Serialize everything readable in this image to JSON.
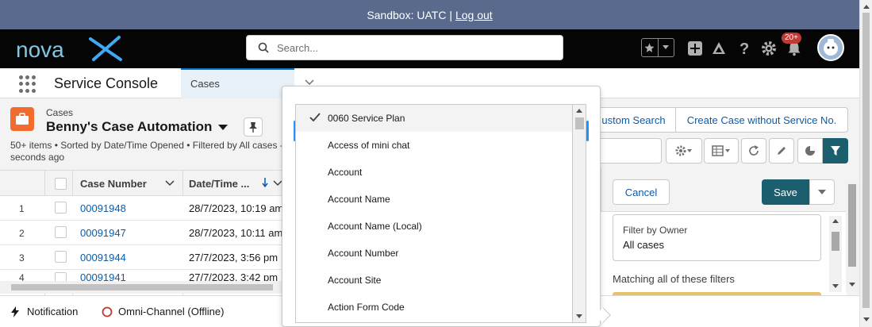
{
  "sandbox": {
    "text": "Sandbox: UATC |",
    "logout": "Log out"
  },
  "header": {
    "brand": "nova",
    "search_placeholder": "Search...",
    "notification_count": "20+"
  },
  "console": {
    "app_name": "Service Console",
    "tab": "Cases"
  },
  "list": {
    "object_label": "Cases",
    "title": "Benny's Case Automation",
    "meta_line1": "50+ items • Sorted by Date/Time Opened • Filtered by All cases -",
    "meta_line2": "seconds ago",
    "columns": {
      "case_number": "Case Number",
      "date_time": "Date/Time ..."
    },
    "rows": [
      {
        "num": "1",
        "case": "00091948",
        "date": "28/7/2023, 10:19 am"
      },
      {
        "num": "2",
        "case": "00091947",
        "date": "28/7/2023, 10:11 am"
      },
      {
        "num": "3",
        "case": "00091944",
        "date": "27/7/2023, 3:56 pm"
      },
      {
        "num": "4",
        "case": "00091941",
        "date": "27/7/2023, 3:42 pm"
      }
    ]
  },
  "toolbar": {
    "custom_search": "ustom Search",
    "create_case": "Create Case without Service No."
  },
  "filter_panel": {
    "cancel": "Cancel",
    "save": "Save",
    "owner_label": "Filter by Owner",
    "owner_value": "All cases",
    "matching": "Matching all of these filters"
  },
  "dropdown": {
    "items": [
      "0060 Service Plan",
      "Access of mini chat",
      "Account",
      "Account Name",
      "Account Name (Local)",
      "Account Number",
      "Account Site",
      "Action Form Code"
    ],
    "selected": "0060 Service Plan"
  },
  "utility_bar": {
    "notification": "Notification",
    "omni": "Omni-Channel (Offline)"
  },
  "colors": {
    "brand_teal": "#1b5f6f",
    "case_orange": "#f26c30",
    "link_blue": "#0b5cab",
    "sandbox_bar": "#5a6a8c"
  }
}
